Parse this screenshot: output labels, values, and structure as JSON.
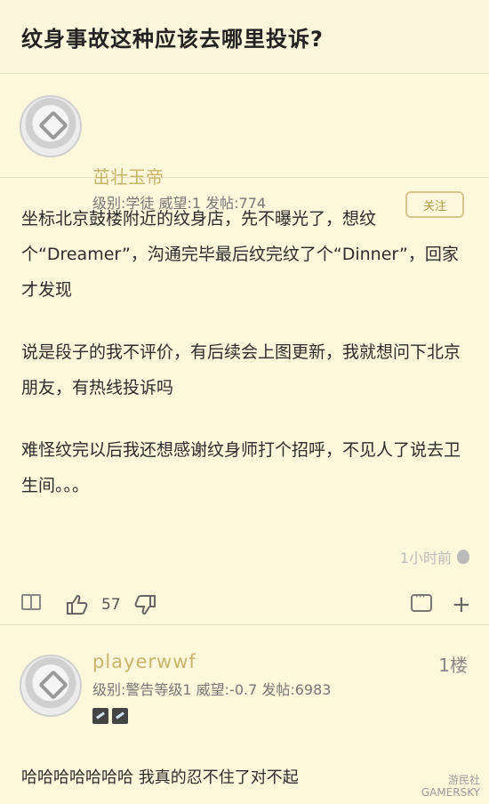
{
  "header": {
    "title": "纹身事故这种应该去哪里投诉?"
  },
  "post": {
    "username": "茁壮玉帝",
    "meta": "级别:学徒 威望:1 发帖:774",
    "meta_dash": "-",
    "follow_label": "关注",
    "paragraphs": [
      "坐标北京鼓楼附近的纹身店，先不曝光了，想纹个“Dreamer”，沟通完毕最后纹完纹了个“Dinner”，回家才发现",
      "说是段子的我不评价，有后续会上图更新，我就想问下北京朋友，有热线投诉吗",
      "难怪纹完以后我还想感谢纹身师打个招呼，不见人了说去卫生间。。。"
    ],
    "time": "1小时前",
    "like_count": "57"
  },
  "reply": {
    "username": "playerwwf",
    "floor": "1楼",
    "meta": "级别:警告等级1 威望:-0.7 发帖:6983",
    "text": "哈哈哈哈哈哈哈 我真的忍不住了对不起"
  },
  "watermark": {
    "line1": "游民社",
    "line2": "GAMERSKY"
  }
}
